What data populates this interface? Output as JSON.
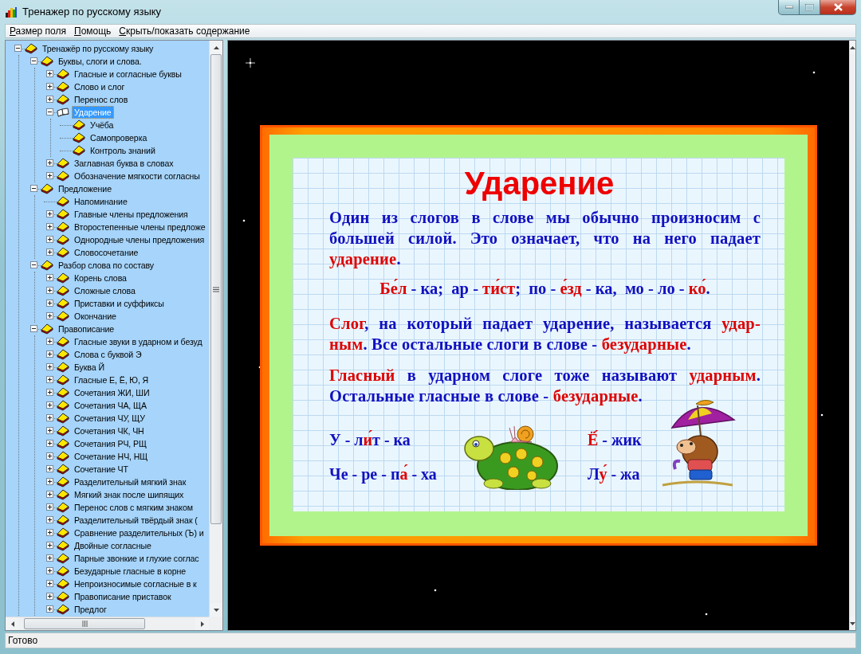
{
  "window": {
    "title": "Тренажер по русскому языку"
  },
  "menu": [
    "Размер поля",
    "Помощь",
    "Скрыть/показать содержание"
  ],
  "tree": {
    "label": "Тренажёр по русскому языку",
    "kind": "expanded",
    "selected": false,
    "children": [
      {
        "label": "Буквы, слоги и слова.",
        "kind": "expanded",
        "selected": false,
        "children": [
          {
            "label": "Гласные и согласные буквы",
            "kind": "collapsed",
            "selected": false
          },
          {
            "label": "Слово и слог",
            "kind": "collapsed",
            "selected": false
          },
          {
            "label": "Перенос слов",
            "kind": "collapsed",
            "selected": false
          },
          {
            "label": "Ударение",
            "kind": "expanded",
            "selected": true,
            "children": [
              {
                "label": "Учёба",
                "kind": "leaf",
                "selected": false
              },
              {
                "label": "Самопроверка",
                "kind": "leaf",
                "selected": false
              },
              {
                "label": "Контроль знаний",
                "kind": "leaf",
                "selected": false
              }
            ]
          },
          {
            "label": "Заглавная буква в словах",
            "kind": "collapsed",
            "selected": false
          },
          {
            "label": "Обозначение мягкости согласны",
            "kind": "collapsed",
            "selected": false
          }
        ]
      },
      {
        "label": "Предложение",
        "kind": "expanded",
        "selected": false,
        "children": [
          {
            "label": "Напоминание",
            "kind": "leaf",
            "selected": false
          },
          {
            "label": "Главные члены предложения",
            "kind": "collapsed",
            "selected": false
          },
          {
            "label": "Второстепенные члены предложе",
            "kind": "collapsed",
            "selected": false
          },
          {
            "label": "Однородные члены предложения",
            "kind": "collapsed",
            "selected": false
          },
          {
            "label": "Словосочетание",
            "kind": "collapsed",
            "selected": false
          }
        ]
      },
      {
        "label": "Разбор слова по составу",
        "kind": "expanded",
        "selected": false,
        "children": [
          {
            "label": "Корень слова",
            "kind": "collapsed",
            "selected": false
          },
          {
            "label": "Сложные слова",
            "kind": "collapsed",
            "selected": false
          },
          {
            "label": "Приставки и суффиксы",
            "kind": "collapsed",
            "selected": false
          },
          {
            "label": "Окончание",
            "kind": "collapsed",
            "selected": false
          }
        ]
      },
      {
        "label": "Правописание",
        "kind": "expanded",
        "selected": false,
        "children": [
          {
            "label": "Гласные звуки в ударном и безуд",
            "kind": "collapsed",
            "selected": false
          },
          {
            "label": "Слова с буквой Э",
            "kind": "collapsed",
            "selected": false
          },
          {
            "label": "Буква Й",
            "kind": "collapsed",
            "selected": false
          },
          {
            "label": "Гласные Е, Ё, Ю, Я",
            "kind": "collapsed",
            "selected": false
          },
          {
            "label": "Сочетания ЖИ, ШИ",
            "kind": "collapsed",
            "selected": false
          },
          {
            "label": "Сочетания ЧА, ЩА",
            "kind": "collapsed",
            "selected": false
          },
          {
            "label": "Сочетания ЧУ, ЩУ",
            "kind": "collapsed",
            "selected": false
          },
          {
            "label": "Сочетания ЧК, ЧН",
            "kind": "collapsed",
            "selected": false
          },
          {
            "label": "Сочетания РЧ, РЩ",
            "kind": "collapsed",
            "selected": false
          },
          {
            "label": "Сочетание НЧ, НЩ",
            "kind": "collapsed",
            "selected": false
          },
          {
            "label": "Сочетание ЧТ",
            "kind": "collapsed",
            "selected": false
          },
          {
            "label": "Разделительный мягкий знак",
            "kind": "collapsed",
            "selected": false
          },
          {
            "label": "Мягкий знак после шипящих",
            "kind": "collapsed",
            "selected": false
          },
          {
            "label": "Перенос слов с мягким знаком",
            "kind": "collapsed",
            "selected": false
          },
          {
            "label": "Разделительный твёрдый знак (",
            "kind": "collapsed",
            "selected": false
          },
          {
            "label": "Сравнение разделительных (Ъ) и",
            "kind": "collapsed",
            "selected": false
          },
          {
            "label": "Двойные согласные",
            "kind": "collapsed",
            "selected": false
          },
          {
            "label": "Парные звонкие и глухие соглас",
            "kind": "collapsed",
            "selected": false
          },
          {
            "label": "Безударные гласные в корне",
            "kind": "collapsed",
            "selected": false
          },
          {
            "label": "Непроизносимые согласные в к",
            "kind": "collapsed",
            "selected": false
          },
          {
            "label": "Правописание приставок",
            "kind": "collapsed",
            "selected": false
          },
          {
            "label": "Предлог",
            "kind": "collapsed",
            "selected": false
          }
        ]
      }
    ]
  },
  "lesson": {
    "title": "Ударение",
    "blocks": [
      {
        "kind": "paragraph",
        "lines": [
          [
            {
              "text": "Один из слогов в слове мы обычно произносим с",
              "accent": false
            }
          ],
          [
            {
              "text": "большей силой. Это означает, что на него падает",
              "accent": false
            }
          ],
          [
            {
              "text": "ударение",
              "accent": true
            },
            {
              "text": ".",
              "accent": false
            }
          ]
        ]
      },
      {
        "kind": "example",
        "lines": [
          [
            {
              "text": "Бе́л",
              "accent": true
            },
            {
              "text": " - ка;  ар - ",
              "accent": false
            },
            {
              "text": "ти́ст",
              "accent": true
            },
            {
              "text": ";  по - ",
              "accent": false
            },
            {
              "text": "е́зд",
              "accent": true
            },
            {
              "text": " - ка,  мо - ло - ",
              "accent": false
            },
            {
              "text": "ко́",
              "accent": true
            },
            {
              "text": ".",
              "accent": false
            }
          ]
        ]
      },
      {
        "kind": "paragraph",
        "lines": [
          [
            {
              "text": "Слог",
              "accent": true
            },
            {
              "text": ", на который падает ударение, называется ",
              "accent": false
            },
            {
              "text": "удар-",
              "accent": true
            }
          ],
          [
            {
              "text": "ным",
              "accent": true
            },
            {
              "text": ". Все остальные слоги в слове - ",
              "accent": false
            },
            {
              "text": "безударные",
              "accent": true
            },
            {
              "text": ".",
              "accent": false
            }
          ]
        ]
      },
      {
        "kind": "paragraph",
        "lines": [
          [
            {
              "text": "Гласный",
              "accent": true
            },
            {
              "text": " в ударном слоге тоже называют ",
              "accent": false
            },
            {
              "text": "ударным",
              "accent": true
            },
            {
              "text": ".",
              "accent": false
            }
          ],
          [
            {
              "text": "Остальные гласные в слове - ",
              "accent": false
            },
            {
              "text": "безударные",
              "accent": true
            },
            {
              "text": ".",
              "accent": false
            }
          ]
        ]
      },
      {
        "kind": "words",
        "columns": [
          {
            "lines": [
              [
                {
                  "text": "У - л",
                  "accent": false
                },
                {
                  "text": "и́",
                  "accent": true
                },
                {
                  "text": "т - ка",
                  "accent": false
                }
              ],
              [
                {
                  "text": "Че - ре - п",
                  "accent": false
                },
                {
                  "text": "а́",
                  "accent": true
                },
                {
                  "text": " - ха",
                  "accent": false
                }
              ]
            ]
          },
          {
            "lines": [
              [
                {
                  "text": "Ё́",
                  "accent": true
                },
                {
                  "text": " - жик",
                  "accent": false
                }
              ],
              [
                {
                  "text": "Л",
                  "accent": false
                },
                {
                  "text": "у́",
                  "accent": true
                },
                {
                  "text": " - жа",
                  "accent": false
                }
              ]
            ]
          }
        ]
      }
    ]
  },
  "status_bar": "Готово"
}
